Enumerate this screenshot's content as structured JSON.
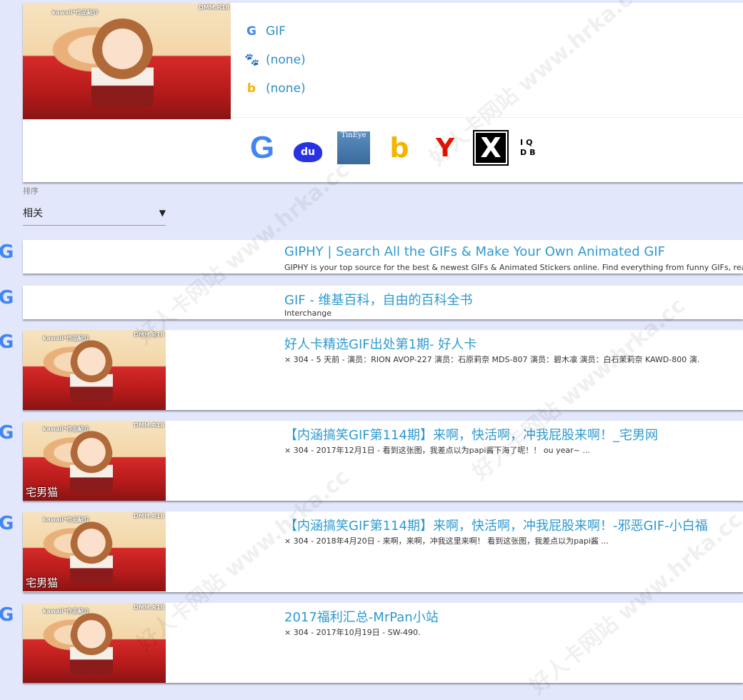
{
  "preview": {
    "thumb_caption": "kawaii*作品紹介",
    "thumb_badge": "DMM.R18"
  },
  "engines": [
    {
      "icon": "google-icon",
      "label": "GIF"
    },
    {
      "icon": "baidu-icon",
      "label": "(none)"
    },
    {
      "icon": "bing-icon",
      "label": "(none)"
    }
  ],
  "search_icons": {
    "tineye": "TinEye",
    "iqdb": "IQDB"
  },
  "sort": {
    "label": "排序",
    "value": "相关"
  },
  "results": [
    {
      "title": "GIPHY | Search All the GIFs & Make Your Own Animated GIF",
      "desc": "GIPHY is your top source for the best & newest GIFs & Animated Stickers online. Find everything from funny GIFs, reactions"
    },
    {
      "title": "GIF - 维基百科，自由的百科全书",
      "desc": "Interchange"
    },
    {
      "title": "好人卡精选GIF出处第1期- 好人卡",
      "desc": "× 304 - 5 天前 - 演员：RION AVOP-227 演员：石原莉奈 MDS-807 演员：碧木凛 演员：白石茉莉奈 KAWD-800 演."
    },
    {
      "title": "【内涵搞笑GIF第114期】来啊，快活啊，冲我屁股来啊！_宅男网",
      "desc": "× 304 - 2017年12月1日 - 看到这张图，我差点以为papi酱下海了呢！！ ou year~ ...",
      "overlay": "宅男猫"
    },
    {
      "title": "【内涵搞笑GIF第114期】来啊，快活啊，冲我屁股来啊！-邪恶GIF-小白福",
      "desc": "× 304 - 2018年4月20日 - 来啊，来啊，冲我这里来啊！ 看到这张图，我差点以为papi酱 ...",
      "overlay": "宅男猫"
    },
    {
      "title": "2017福利汇总-MrPan小站",
      "desc": "× 304 - 2017年10月19日 - SW-490."
    }
  ],
  "watermark": "好人卡网站 www.hrka.cc"
}
